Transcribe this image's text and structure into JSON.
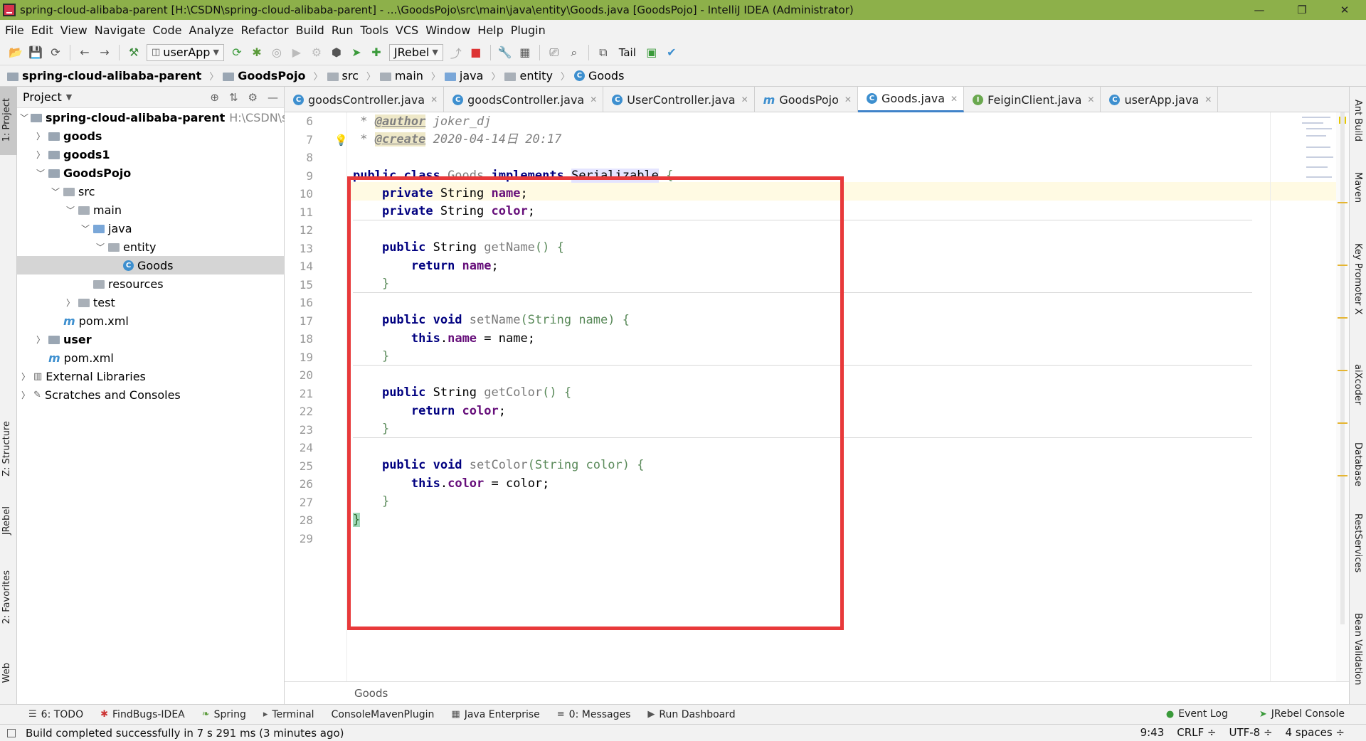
{
  "window": {
    "title": "spring-cloud-alibaba-parent [H:\\CSDN\\spring-cloud-alibaba-parent] - ...\\GoodsPojo\\src\\main\\java\\entity\\Goods.java [GoodsPojo] - IntelliJ IDEA (Administrator)",
    "minimize": "—",
    "maximize": "❐",
    "close": "✕"
  },
  "menu": [
    "File",
    "Edit",
    "View",
    "Navigate",
    "Code",
    "Analyze",
    "Refactor",
    "Build",
    "Run",
    "Tools",
    "VCS",
    "Window",
    "Help",
    "Plugin"
  ],
  "toolbar": {
    "run_config": "userApp",
    "jrebel_config": "JRebel",
    "tail_label": "Tail"
  },
  "breadcrumbs": [
    "spring-cloud-alibaba-parent",
    "GoodsPojo",
    "src",
    "main",
    "java",
    "entity",
    "Goods"
  ],
  "left_tools": [
    "1: Project",
    "Z: Structure",
    "JRebel",
    "2: Favorites",
    "Web"
  ],
  "right_tools": [
    "Ant Build",
    "Maven",
    "Key Promoter X",
    "aiXcoder",
    "Database",
    "RestServices",
    "Bean Validation"
  ],
  "project": {
    "header": "Project",
    "tree": [
      {
        "label": "spring-cloud-alibaba-parent",
        "path": "H:\\CSDN\\sprir",
        "depth": 0,
        "open": true,
        "bold": true,
        "icon": "module-folder"
      },
      {
        "label": "goods",
        "depth": 1,
        "open": false,
        "bold": true,
        "icon": "module-folder"
      },
      {
        "label": "goods1",
        "depth": 1,
        "open": false,
        "bold": true,
        "icon": "module-folder"
      },
      {
        "label": "GoodsPojo",
        "depth": 1,
        "open": true,
        "bold": true,
        "icon": "module-folder"
      },
      {
        "label": "src",
        "depth": 2,
        "open": true,
        "bold": false,
        "icon": "folder"
      },
      {
        "label": "main",
        "depth": 3,
        "open": true,
        "bold": false,
        "icon": "folder"
      },
      {
        "label": "java",
        "depth": 4,
        "open": true,
        "bold": false,
        "icon": "source-folder"
      },
      {
        "label": "entity",
        "depth": 5,
        "open": true,
        "bold": false,
        "icon": "package"
      },
      {
        "label": "Goods",
        "depth": 6,
        "open": null,
        "bold": false,
        "icon": "class",
        "selected": true
      },
      {
        "label": "resources",
        "depth": 4,
        "open": null,
        "bold": false,
        "icon": "folder"
      },
      {
        "label": "test",
        "depth": 3,
        "open": false,
        "bold": false,
        "icon": "folder"
      },
      {
        "label": "pom.xml",
        "depth": 2,
        "open": null,
        "bold": false,
        "icon": "maven"
      },
      {
        "label": "user",
        "depth": 1,
        "open": false,
        "bold": true,
        "icon": "module-folder"
      },
      {
        "label": "pom.xml",
        "depth": 1,
        "open": null,
        "bold": false,
        "icon": "maven"
      },
      {
        "label": "External Libraries",
        "depth": 0,
        "open": false,
        "bold": false,
        "icon": "libraries"
      },
      {
        "label": "Scratches and Consoles",
        "depth": 0,
        "open": false,
        "bold": false,
        "icon": "scratches"
      }
    ]
  },
  "tabs": [
    {
      "label": "goodsController.java",
      "icon": "C",
      "active": false
    },
    {
      "label": "goodsController.java",
      "icon": "C",
      "active": false
    },
    {
      "label": "UserController.java",
      "icon": "C",
      "active": false
    },
    {
      "label": "GoodsPojo",
      "icon": "m",
      "active": false
    },
    {
      "label": "Goods.java",
      "icon": "C",
      "active": true
    },
    {
      "label": "FeiginClient.java",
      "icon": "I",
      "active": false
    },
    {
      "label": "userApp.java",
      "icon": "C",
      "active": false
    }
  ],
  "editor": {
    "line_numbers": [
      "6",
      "7",
      "8",
      "9",
      "10",
      "11",
      "12",
      "13",
      "14",
      "15",
      "16",
      "17",
      "18",
      "19",
      "20",
      "21",
      "22",
      "23",
      "24",
      "25",
      "26",
      "27",
      "28",
      "29"
    ],
    "comment_author_tag": "@author",
    "comment_author": "joker_dj",
    "comment_create_tag": "@create",
    "comment_create": "2020-04-14日 20:17",
    "class_decl": [
      "public class ",
      "Goods",
      " implements ",
      "Serializable",
      " {"
    ],
    "field_name": [
      "private ",
      "String ",
      "name",
      ";"
    ],
    "field_color": [
      "private ",
      "String ",
      "color",
      ";"
    ],
    "getName": [
      "public ",
      "String ",
      "getName",
      "() {"
    ],
    "return_name": [
      "return ",
      "name",
      ";"
    ],
    "setName": [
      "public void ",
      "setName",
      "(String name) {"
    ],
    "set_name_body": [
      "this",
      ".",
      "name",
      " = name;"
    ],
    "getColor": [
      "public ",
      "String ",
      "getColor",
      "() {"
    ],
    "return_color": [
      "return ",
      "color",
      ";"
    ],
    "setColor": [
      "public void ",
      "setColor",
      "(String color) {"
    ],
    "set_color_body": [
      "this",
      ".",
      "color",
      " = color;"
    ],
    "close_brace": "}"
  },
  "editor_breadcrumb": "Goods",
  "bottom_tools": [
    "6: TODO",
    "FindBugs-IDEA",
    "Spring",
    "Terminal",
    "ConsoleMavenPlugin",
    "Java Enterprise",
    "0: Messages",
    "Run Dashboard"
  ],
  "bottom_right_tools": [
    "Event Log",
    "JRebel Console"
  ],
  "status": {
    "message": "Build completed successfully in 7 s 291 ms (3 minutes ago)",
    "position": "9:43",
    "line_sep": "CRLF ÷",
    "encoding": "UTF-8 ÷",
    "indent": "4 spaces ÷"
  },
  "colors": {
    "title_bar": "#8db04a",
    "highlight_box": "#e8393a",
    "keyword": "#000080",
    "field": "#660e7a"
  }
}
